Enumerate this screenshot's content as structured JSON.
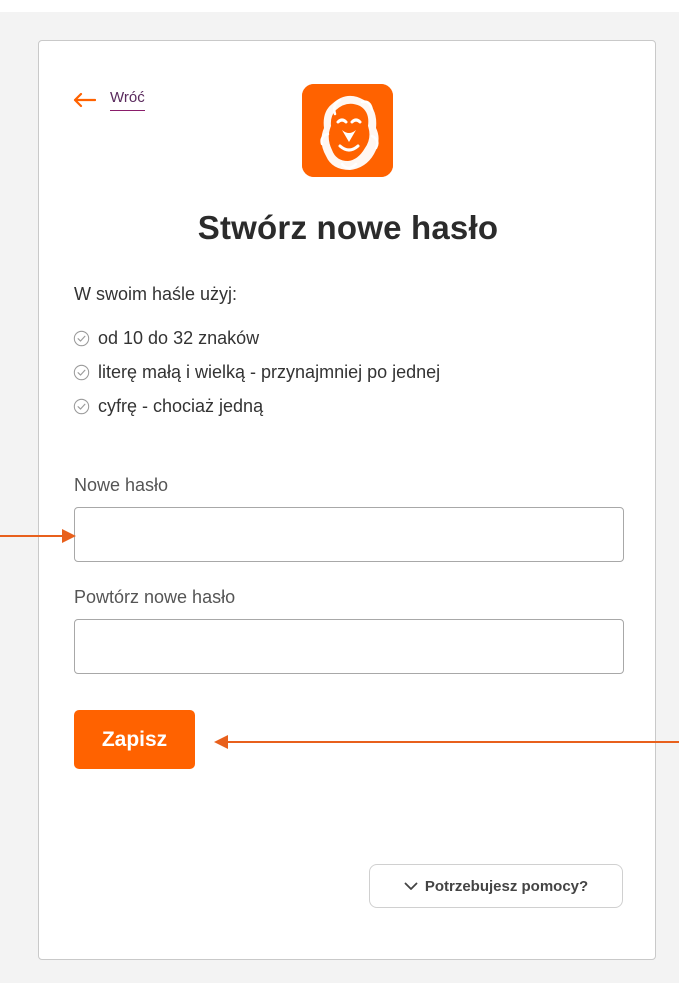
{
  "back": {
    "label": "Wróć"
  },
  "logo": {
    "icon": "lion-logo-icon",
    "color": "#ff6200"
  },
  "page": {
    "title": "Stwórz nowe hasło"
  },
  "requirements": {
    "intro": "W swoim haśle użyj:",
    "items": [
      {
        "text": "od 10 do 32 znaków",
        "icon": "check-circle-icon"
      },
      {
        "text": "literę małą i wielką - przynajmniej po jednej",
        "icon": "check-circle-icon"
      },
      {
        "text": "cyfrę - chociaż jedną",
        "icon": "check-circle-icon"
      }
    ]
  },
  "form": {
    "new_password_label": "Nowe hasło",
    "new_password_value": "",
    "repeat_password_label": "Powtórz nowe hasło",
    "repeat_password_value": "",
    "save_label": "Zapisz"
  },
  "help": {
    "label": "Potrzebujesz pomocy?",
    "icon": "chevron-down-icon"
  },
  "colors": {
    "accent": "#ff6200",
    "link": "#5a2a5d",
    "annotation": "#e8601c"
  }
}
